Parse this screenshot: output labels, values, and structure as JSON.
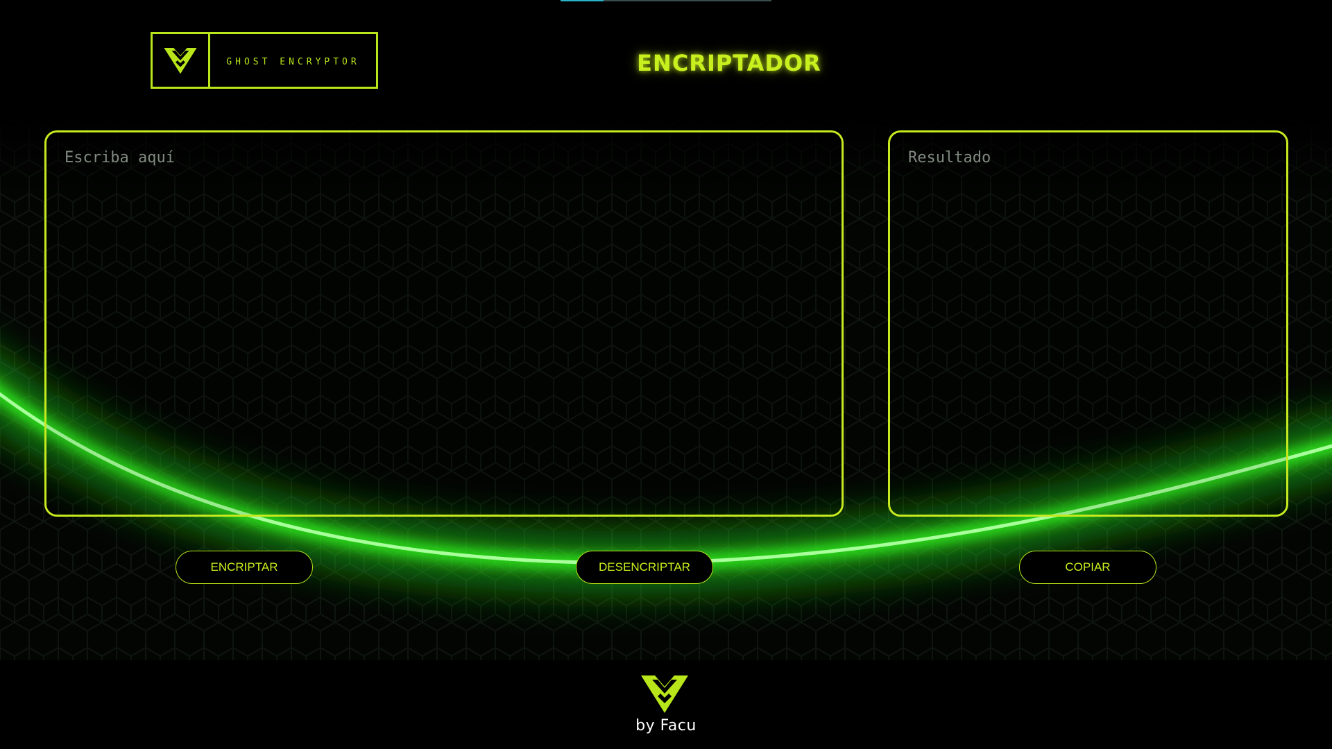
{
  "header": {
    "logo_text": "GHOST ENCRYPTOR",
    "title": "ENCRIPTADOR"
  },
  "editor": {
    "input_placeholder": "Escriba aquí",
    "output_placeholder": "Resultado"
  },
  "actions": {
    "encrypt_label": "ENCRIPTAR",
    "decrypt_label": "DESENCRIPTAR",
    "copy_label": "COPIAR"
  },
  "footer": {
    "credit": "by Facu"
  },
  "icons": {
    "brand": "ghost-logo-icon"
  },
  "colors": {
    "accent": "#c6ea1f",
    "background": "#000000",
    "glow": "#38ff28"
  }
}
